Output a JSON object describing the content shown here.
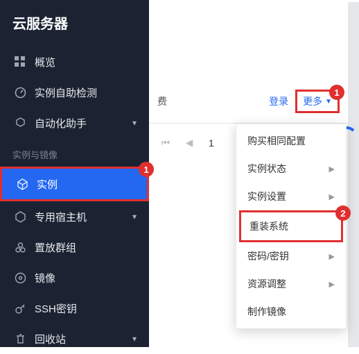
{
  "sidebar": {
    "title": "云服务器",
    "items": [
      {
        "label": "概览"
      },
      {
        "label": "实例自助检测"
      },
      {
        "label": "自动化助手"
      },
      {
        "label": "实例"
      },
      {
        "label": "专用宿主机"
      },
      {
        "label": "置放群组"
      },
      {
        "label": "镜像"
      },
      {
        "label": "SSH密钥"
      },
      {
        "label": "回收站"
      }
    ],
    "section_label": "实例与镜像"
  },
  "main": {
    "fee_label": "费",
    "login_link": "登录",
    "more_label": "更多",
    "pager": {
      "current": "1"
    }
  },
  "dropdown": {
    "items": [
      {
        "label": "购买相同配置"
      },
      {
        "label": "实例状态"
      },
      {
        "label": "实例设置"
      },
      {
        "label": "重装系统"
      },
      {
        "label": "密码/密钥"
      },
      {
        "label": "资源调整"
      },
      {
        "label": "制作镜像"
      }
    ]
  },
  "annotations": {
    "badge1": "1",
    "badge2": "2"
  }
}
